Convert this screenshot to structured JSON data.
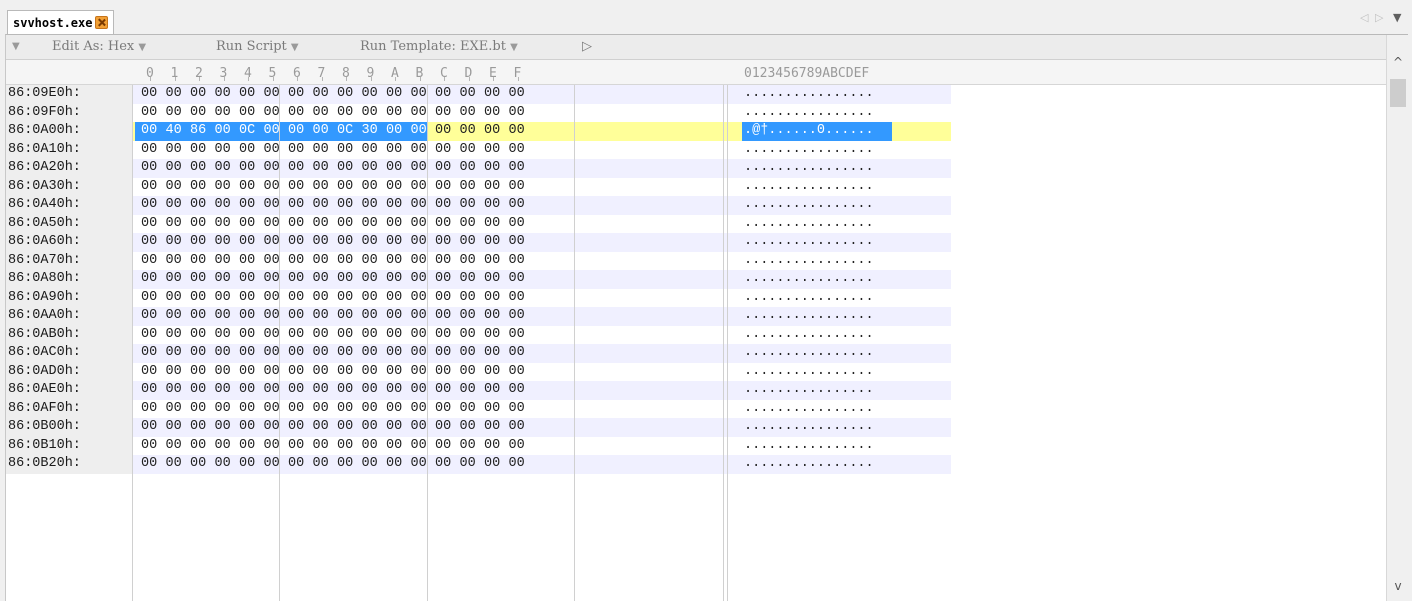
{
  "tab": {
    "title": "svvhost.exe",
    "close_icon": "close-icon"
  },
  "tab_nav": {
    "prev": "◁",
    "next": "▷",
    "menu": "▼"
  },
  "toolbar": {
    "collapse": "▼",
    "edit_as": "Edit As: Hex",
    "run_script": "Run Script",
    "run_template": "Run Template: EXE.bt",
    "play": "▷",
    "caret": "▼"
  },
  "columns": [
    "0",
    "1",
    "2",
    "3",
    "4",
    "5",
    "6",
    "7",
    "8",
    "9",
    "A",
    "B",
    "C",
    "D",
    "E",
    "F"
  ],
  "ascii_header": "0123456789ABCDEF",
  "rows": [
    {
      "addr": "86:09E0h:",
      "bytes": [
        "00",
        "00",
        "00",
        "00",
        "00",
        "00",
        "00",
        "00",
        "00",
        "00",
        "00",
        "00",
        "00",
        "00",
        "00",
        "00"
      ],
      "ascii": "................"
    },
    {
      "addr": "86:09F0h:",
      "bytes": [
        "00",
        "00",
        "00",
        "00",
        "00",
        "00",
        "00",
        "00",
        "00",
        "00",
        "00",
        "00",
        "00",
        "00",
        "00",
        "00"
      ],
      "ascii": "................"
    },
    {
      "addr": "86:0A00h:",
      "bytes": [
        "00",
        "40",
        "86",
        "00",
        "0C",
        "00",
        "00",
        "00",
        "0C",
        "30",
        "00",
        "00",
        "00",
        "00",
        "00",
        "00"
      ],
      "ascii": ".@†......0......"
    },
    {
      "addr": "86:0A10h:",
      "bytes": [
        "00",
        "00",
        "00",
        "00",
        "00",
        "00",
        "00",
        "00",
        "00",
        "00",
        "00",
        "00",
        "00",
        "00",
        "00",
        "00"
      ],
      "ascii": "................"
    },
    {
      "addr": "86:0A20h:",
      "bytes": [
        "00",
        "00",
        "00",
        "00",
        "00",
        "00",
        "00",
        "00",
        "00",
        "00",
        "00",
        "00",
        "00",
        "00",
        "00",
        "00"
      ],
      "ascii": "................"
    },
    {
      "addr": "86:0A30h:",
      "bytes": [
        "00",
        "00",
        "00",
        "00",
        "00",
        "00",
        "00",
        "00",
        "00",
        "00",
        "00",
        "00",
        "00",
        "00",
        "00",
        "00"
      ],
      "ascii": "................"
    },
    {
      "addr": "86:0A40h:",
      "bytes": [
        "00",
        "00",
        "00",
        "00",
        "00",
        "00",
        "00",
        "00",
        "00",
        "00",
        "00",
        "00",
        "00",
        "00",
        "00",
        "00"
      ],
      "ascii": "................"
    },
    {
      "addr": "86:0A50h:",
      "bytes": [
        "00",
        "00",
        "00",
        "00",
        "00",
        "00",
        "00",
        "00",
        "00",
        "00",
        "00",
        "00",
        "00",
        "00",
        "00",
        "00"
      ],
      "ascii": "................"
    },
    {
      "addr": "86:0A60h:",
      "bytes": [
        "00",
        "00",
        "00",
        "00",
        "00",
        "00",
        "00",
        "00",
        "00",
        "00",
        "00",
        "00",
        "00",
        "00",
        "00",
        "00"
      ],
      "ascii": "................"
    },
    {
      "addr": "86:0A70h:",
      "bytes": [
        "00",
        "00",
        "00",
        "00",
        "00",
        "00",
        "00",
        "00",
        "00",
        "00",
        "00",
        "00",
        "00",
        "00",
        "00",
        "00"
      ],
      "ascii": "................"
    },
    {
      "addr": "86:0A80h:",
      "bytes": [
        "00",
        "00",
        "00",
        "00",
        "00",
        "00",
        "00",
        "00",
        "00",
        "00",
        "00",
        "00",
        "00",
        "00",
        "00",
        "00"
      ],
      "ascii": "................"
    },
    {
      "addr": "86:0A90h:",
      "bytes": [
        "00",
        "00",
        "00",
        "00",
        "00",
        "00",
        "00",
        "00",
        "00",
        "00",
        "00",
        "00",
        "00",
        "00",
        "00",
        "00"
      ],
      "ascii": "................"
    },
    {
      "addr": "86:0AA0h:",
      "bytes": [
        "00",
        "00",
        "00",
        "00",
        "00",
        "00",
        "00",
        "00",
        "00",
        "00",
        "00",
        "00",
        "00",
        "00",
        "00",
        "00"
      ],
      "ascii": "................"
    },
    {
      "addr": "86:0AB0h:",
      "bytes": [
        "00",
        "00",
        "00",
        "00",
        "00",
        "00",
        "00",
        "00",
        "00",
        "00",
        "00",
        "00",
        "00",
        "00",
        "00",
        "00"
      ],
      "ascii": "................"
    },
    {
      "addr": "86:0AC0h:",
      "bytes": [
        "00",
        "00",
        "00",
        "00",
        "00",
        "00",
        "00",
        "00",
        "00",
        "00",
        "00",
        "00",
        "00",
        "00",
        "00",
        "00"
      ],
      "ascii": "................"
    },
    {
      "addr": "86:0AD0h:",
      "bytes": [
        "00",
        "00",
        "00",
        "00",
        "00",
        "00",
        "00",
        "00",
        "00",
        "00",
        "00",
        "00",
        "00",
        "00",
        "00",
        "00"
      ],
      "ascii": "................"
    },
    {
      "addr": "86:0AE0h:",
      "bytes": [
        "00",
        "00",
        "00",
        "00",
        "00",
        "00",
        "00",
        "00",
        "00",
        "00",
        "00",
        "00",
        "00",
        "00",
        "00",
        "00"
      ],
      "ascii": "................"
    },
    {
      "addr": "86:0AF0h:",
      "bytes": [
        "00",
        "00",
        "00",
        "00",
        "00",
        "00",
        "00",
        "00",
        "00",
        "00",
        "00",
        "00",
        "00",
        "00",
        "00",
        "00"
      ],
      "ascii": "................"
    },
    {
      "addr": "86:0B00h:",
      "bytes": [
        "00",
        "00",
        "00",
        "00",
        "00",
        "00",
        "00",
        "00",
        "00",
        "00",
        "00",
        "00",
        "00",
        "00",
        "00",
        "00"
      ],
      "ascii": "................"
    },
    {
      "addr": "86:0B10h:",
      "bytes": [
        "00",
        "00",
        "00",
        "00",
        "00",
        "00",
        "00",
        "00",
        "00",
        "00",
        "00",
        "00",
        "00",
        "00",
        "00",
        "00"
      ],
      "ascii": "................"
    },
    {
      "addr": "86:0B20h:",
      "bytes": [
        "00",
        "00",
        "00",
        "00",
        "00",
        "00",
        "00",
        "00",
        "00",
        "00",
        "00",
        "00",
        "00",
        "00",
        "00",
        "00"
      ],
      "ascii": "................"
    }
  ],
  "selection": {
    "row_index": 2,
    "blue_byte_count": 12,
    "blue_ascii_count": 12,
    "blue_color": "#3399ff",
    "yellow_color": "#ffff99"
  },
  "scrollbar": {
    "up": "^",
    "down": "v"
  }
}
